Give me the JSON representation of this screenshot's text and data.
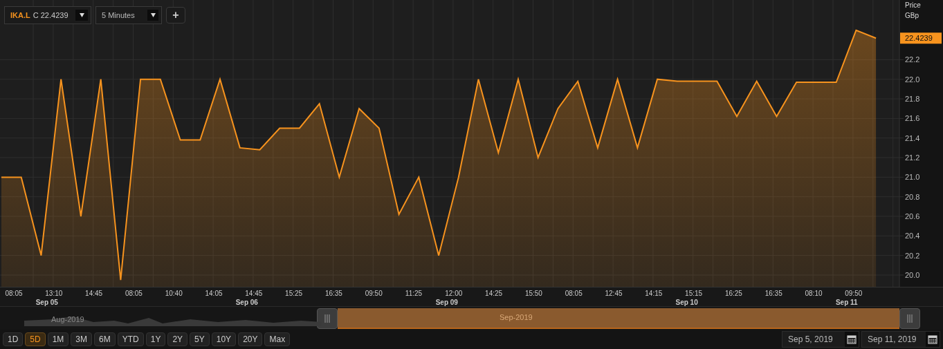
{
  "toolbar": {
    "price_label": "C 22.4239",
    "interval": "5 Minutes",
    "add_button": "+"
  },
  "chart": {
    "axis_title": "Price",
    "currency": "GBp",
    "last_price": "22.4239",
    "time_labels": [
      {
        "label": "08:05"
      },
      {
        "label": "13:10",
        "day": "Sep 05"
      },
      {
        "label": "14:45"
      },
      {
        "label": "08:05"
      },
      {
        "label": "10:40"
      },
      {
        "label": "14:05"
      },
      {
        "label": "14:45",
        "day": "Sep 06"
      },
      {
        "label": "15:25"
      },
      {
        "label": "16:35"
      },
      {
        "label": "09:50"
      },
      {
        "label": "11:25"
      },
      {
        "label": "12:00",
        "day": "Sep 09"
      },
      {
        "label": "14:25"
      },
      {
        "label": "15:50"
      },
      {
        "label": "08:05"
      },
      {
        "label": "12:45"
      },
      {
        "label": "14:15"
      },
      {
        "label": "15:15",
        "day": "Sep 10"
      },
      {
        "label": "16:25"
      },
      {
        "label": "16:35"
      },
      {
        "label": "08:10"
      },
      {
        "label": "09:50",
        "day": "Sep 11"
      }
    ],
    "chart_data": {
      "type": "area",
      "grid": true,
      "series": [
        {
          "name": "IKA.L",
          "color": "#f7931e",
          "values": [
            21.0,
            21.0,
            20.2,
            22.0,
            20.6,
            22.0,
            19.95,
            22.0,
            22.0,
            21.38,
            21.38,
            22.0,
            21.3,
            21.28,
            21.5,
            21.5,
            21.75,
            21.0,
            21.7,
            21.5,
            20.62,
            21.0,
            20.2,
            21.0,
            22.0,
            21.25,
            22.0,
            21.2,
            21.7,
            21.98,
            21.3,
            22.0,
            21.3,
            22.0,
            21.98,
            21.98,
            21.98,
            21.62,
            21.98,
            21.62,
            21.97,
            21.97,
            21.97,
            22.5,
            22.42
          ]
        }
      ],
      "ylim": [
        19.88,
        22.81
      ],
      "yticks": [
        {
          "value": 20.0,
          "label": "20.0"
        },
        {
          "value": 20.2,
          "label": "20.2"
        },
        {
          "value": 20.4,
          "label": "20.4"
        },
        {
          "value": 20.6,
          "label": "20.6"
        },
        {
          "value": 20.8,
          "label": "20.8"
        },
        {
          "value": 21.0,
          "label": "21.0"
        },
        {
          "value": 21.2,
          "label": "21.2"
        },
        {
          "value": 21.4,
          "label": "21.4"
        },
        {
          "value": 21.6,
          "label": "21.6"
        },
        {
          "value": 21.8,
          "label": "21.8"
        },
        {
          "value": 22.0,
          "label": "22.0"
        },
        {
          "value": 22.2,
          "label": "22.2"
        }
      ]
    }
  },
  "navigator": {
    "left_label": "Aug-2019",
    "selected_label": "Sep-2019"
  },
  "ranges": [
    {
      "label": "1D",
      "selected": false
    },
    {
      "label": "5D",
      "selected": true
    },
    {
      "label": "1M",
      "selected": false
    },
    {
      "label": "3M",
      "selected": false
    },
    {
      "label": "6M",
      "selected": false
    },
    {
      "label": "YTD",
      "selected": false
    },
    {
      "label": "1Y",
      "selected": false
    },
    {
      "label": "2Y",
      "selected": false
    },
    {
      "label": "5Y",
      "selected": false
    },
    {
      "label": "10Y",
      "selected": false
    },
    {
      "label": "20Y",
      "selected": false
    },
    {
      "label": "Max",
      "selected": false
    }
  ],
  "date_from": "Sep 5, 2019",
  "date_to": "Sep 11, 2019"
}
